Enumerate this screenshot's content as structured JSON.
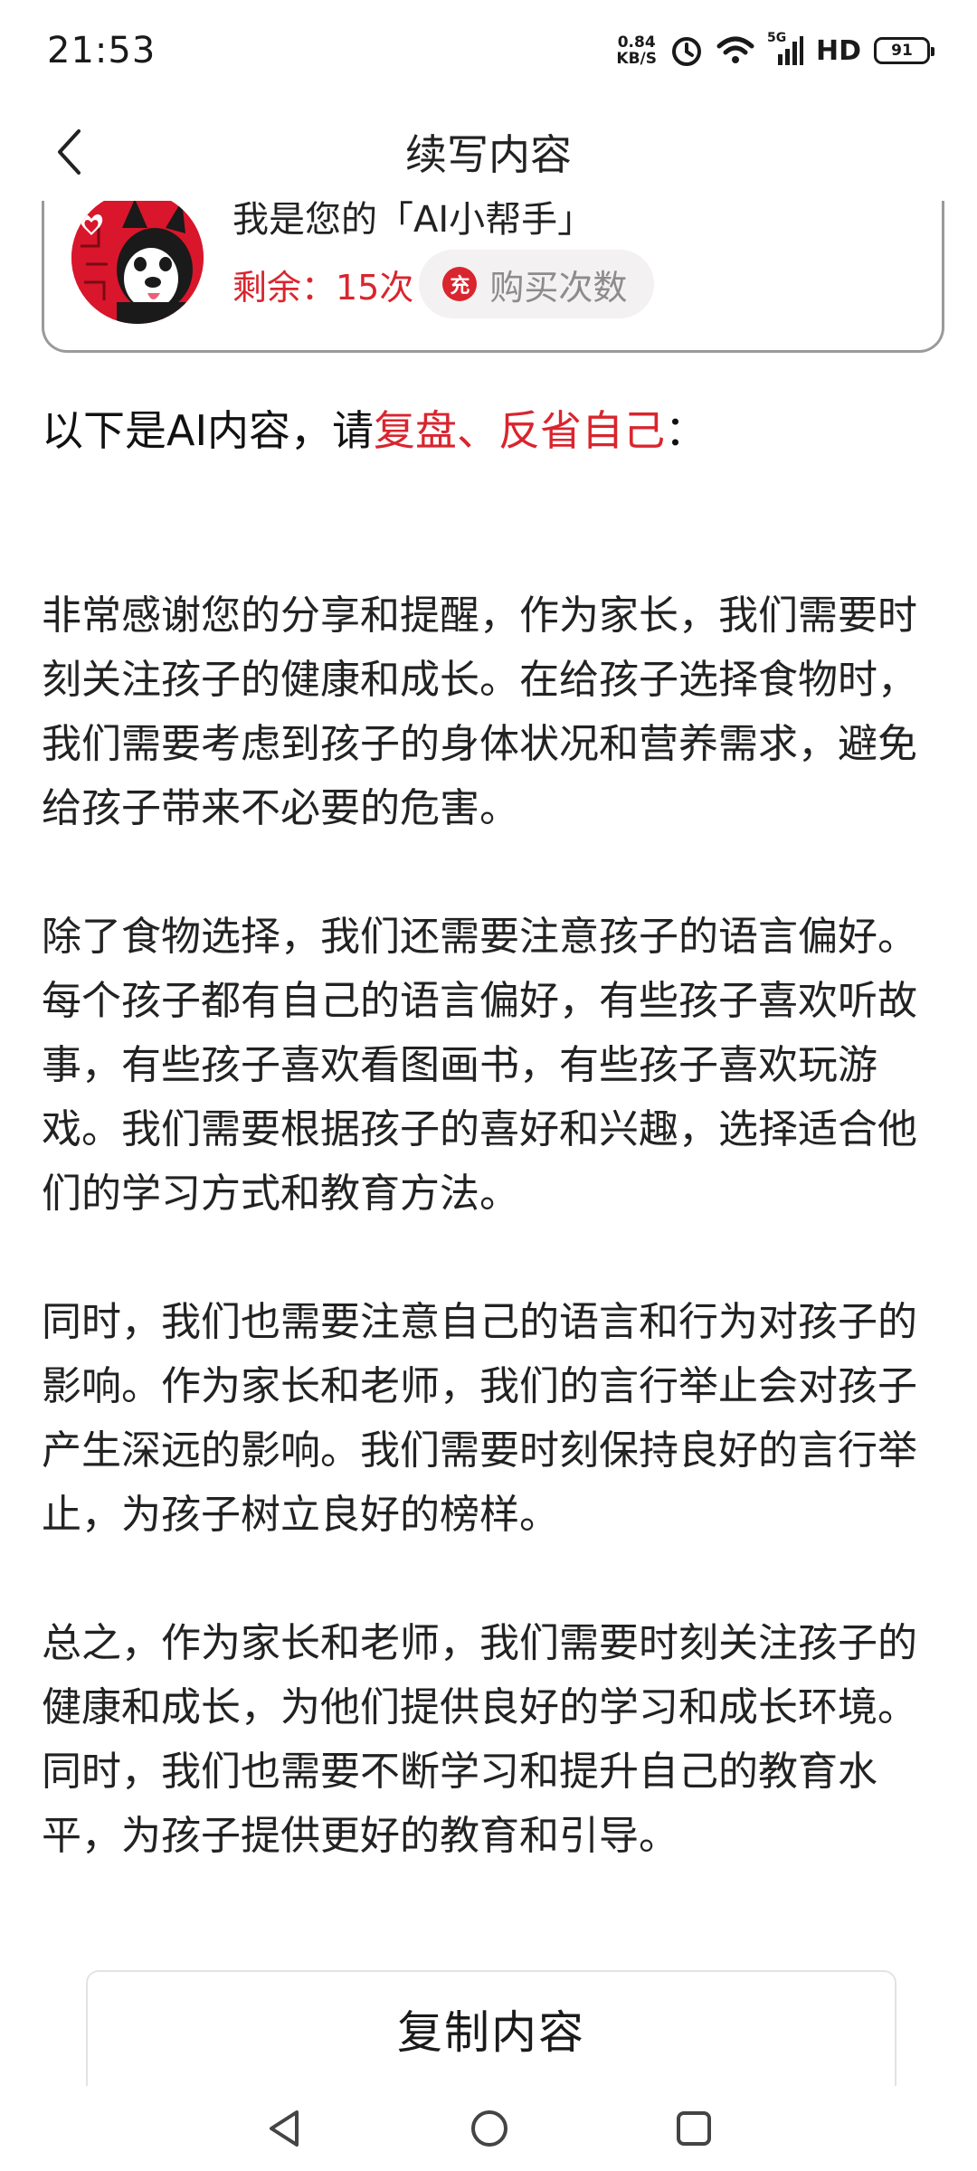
{
  "status_bar": {
    "time": "21:53",
    "net_speed_value": "0.84",
    "net_speed_unit": "KB/S",
    "network_label": "5G",
    "hd_label": "HD",
    "battery": "91"
  },
  "header": {
    "title": "续写内容"
  },
  "helper_card": {
    "title": "我是您的「AI小帮手」",
    "remaining": "剩余：15次",
    "charge_badge": "充",
    "buy_label": "购买次数"
  },
  "intro": {
    "prefix": "以下是AI内容，请",
    "highlight": "复盘、反省自己",
    "suffix": "："
  },
  "content": {
    "paragraphs": [
      "非常感谢您的分享和提醒，作为家长，我们需要时刻关注孩子的健康和成长。在给孩子选择食物时，我们需要考虑到孩子的身体状况和营养需求，避免给孩子带来不必要的危害。",
      "除了食物选择，我们还需要注意孩子的语言偏好。每个孩子都有自己的语言偏好，有些孩子喜欢听故事，有些孩子喜欢看图画书，有些孩子喜欢玩游戏。我们需要根据孩子的喜好和兴趣，选择适合他们的学习方式和教育方法。",
      "同时，我们也需要注意自己的语言和行为对孩子的影响。作为家长和老师，我们的言行举止会对孩子产生深远的影响。我们需要时刻保持良好的言行举止，为孩子树立良好的榜样。",
      "总之，作为家长和老师，我们需要时刻关注孩子的健康和成长，为他们提供良好的学习和成长环境。同时，我们也需要不断学习和提升自己的教育水平，为孩子提供更好的教育和引导。"
    ]
  },
  "actions": {
    "copy_label": "复制内容"
  },
  "colors": {
    "accent_red": "#d9252e",
    "avatar_red": "#d9162b",
    "card_border": "#9a9a9a",
    "button_bg": "#f3f1f1"
  }
}
